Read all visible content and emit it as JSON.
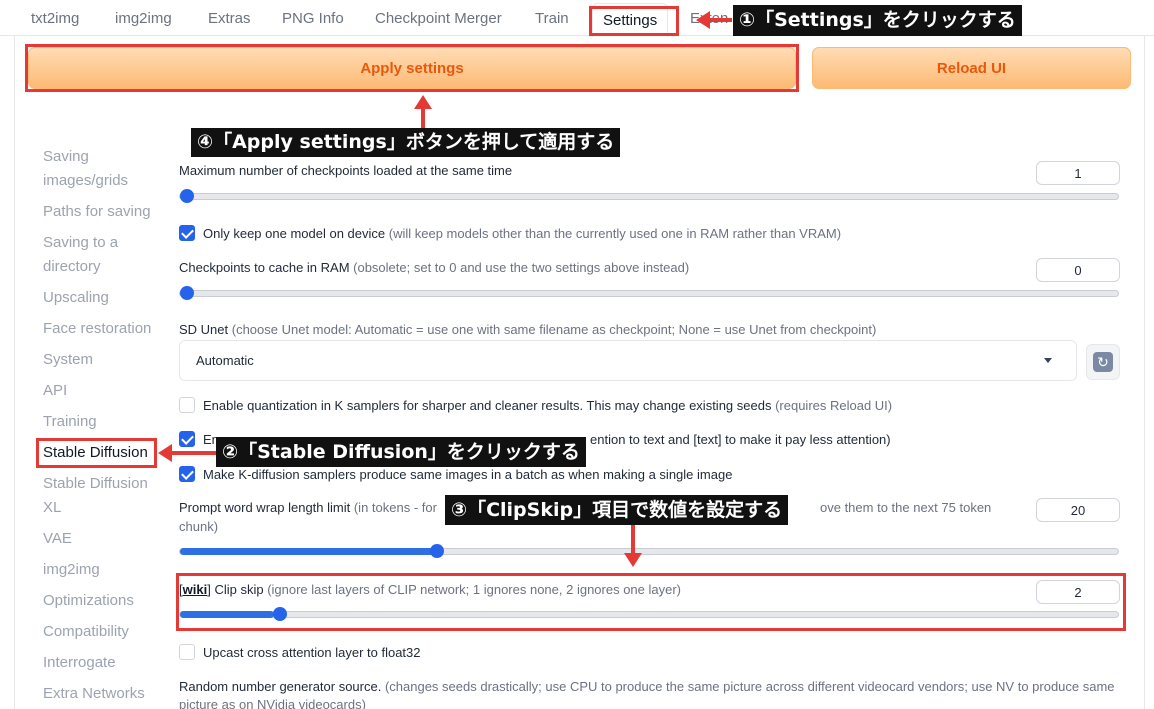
{
  "tabs": [
    "txt2img",
    "img2img",
    "Extras",
    "PNG Info",
    "Checkpoint Merger",
    "Train",
    "Settings",
    "Exten"
  ],
  "active_tab": "Settings",
  "buttons": {
    "apply": "Apply settings",
    "reload": "Reload UI"
  },
  "sidebar": {
    "items": [
      "Saving images/grids",
      "Paths for saving",
      "Saving to a directory",
      "Upscaling",
      "Face restoration",
      "System",
      "API",
      "Training",
      "Stable Diffusion",
      "Stable Diffusion XL",
      "VAE",
      "img2img",
      "Optimizations",
      "Compatibility",
      "Interrogate",
      "Extra Networks"
    ],
    "active": "Stable Diffusion"
  },
  "settings": {
    "max_checkpoints": {
      "label": "Maximum number of checkpoints loaded at the same time",
      "value": "1",
      "fraction": 0
    },
    "one_model": {
      "label": "Only keep one model on device",
      "hint": " (will keep models other than the currently used one in RAM rather than VRAM)",
      "checked": true
    },
    "cache_ram": {
      "label": "Checkpoints to cache in RAM",
      "hint": " (obsolete; set to 0 and use the two settings above instead)",
      "value": "0",
      "fraction": 0
    },
    "sd_unet": {
      "label": "SD Unet",
      "hint": " (choose Unet model: Automatic = use one with same filename as checkpoint; None = use Unet from checkpoint)",
      "value": "Automatic"
    },
    "quantization": {
      "label": "Enable quantization in K samplers for sharper and cleaner results. This may change existing seeds",
      "hint": " (requires Reload UI)",
      "checked": false
    },
    "emphasis": {
      "label_start": "Ena",
      "label_end": "ention to text and [text] to make it pay less attention)",
      "checked": true
    },
    "kdiffusion": {
      "label_start": "Make K-diffusion samplers produce same images in a batch as when making a single image",
      "checked": true
    },
    "wrap_limit": {
      "label": "Prompt word wrap length limit",
      "hint_start": " (in tokens - for",
      "hint_end": "ove them to the next 75 token",
      "hint_line2": "chunk)",
      "value": "20",
      "fraction": 0.27
    },
    "clip_skip": {
      "wiki": "wiki",
      "label": " Clip skip",
      "hint": " (ignore last layers of CLIP network; 1 ignores none, 2 ignores one layer)",
      "value": "2",
      "fraction": 0.1
    },
    "upcast": {
      "label": "Upcast cross attention layer to float32",
      "checked": false
    },
    "rng": {
      "label": "Random number generator source.",
      "hint": " (changes seeds drastically; use CPU to produce the same picture across different videocard vendors; use NV to produce same",
      "hint_line2": "picture as on NVidia videocards)"
    }
  },
  "annotations": {
    "step1": "①「Settings」をクリックする",
    "step2": "②「Stable Diffusion」をクリックする",
    "step3": "③「ClipSkip」項目で数値を設定する",
    "step4": "④「Apply settings」ボタンを押して適用する"
  },
  "icons": {
    "refresh": "refresh-icon",
    "dropdown": "chevron-down-icon"
  },
  "colors": {
    "accent": "#2563eb",
    "annotation_red": "#e53935",
    "button_orange": "#ea580c"
  }
}
